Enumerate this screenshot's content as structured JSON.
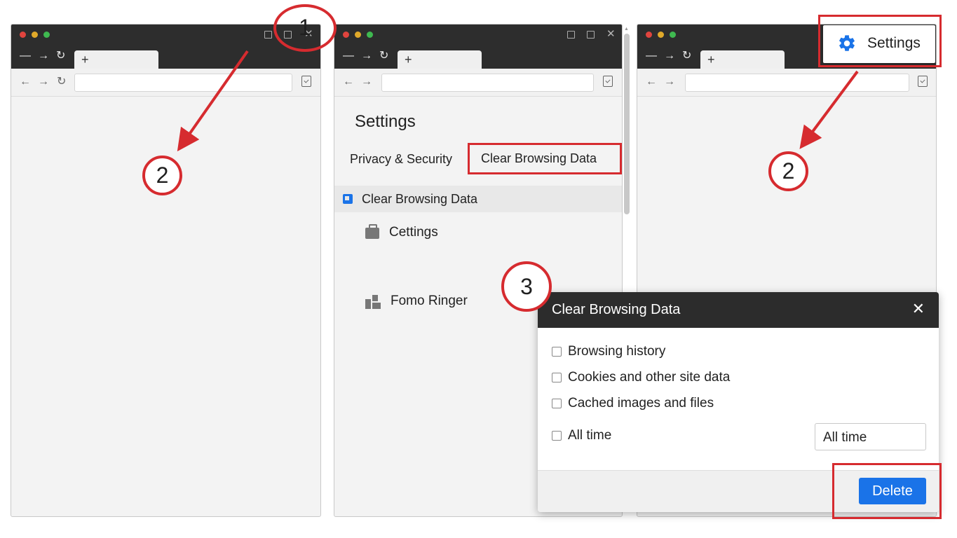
{
  "windows": [
    {
      "new_tab_label": "+"
    },
    {
      "new_tab_label": "+"
    },
    {
      "new_tab_label": "+"
    }
  ],
  "settings_page": {
    "title": "Settings",
    "tabs": [
      "Privacy & Security",
      "Clear Browsing Data"
    ],
    "items": [
      {
        "label": "Clear Browsing Data",
        "icon": "clear-data-icon"
      },
      {
        "label": "Cettings",
        "icon": "briefcase-icon"
      },
      {
        "label": "Fomo Ringer",
        "icon": "puzzle-icon"
      }
    ]
  },
  "settings_popup": {
    "label": "Settings",
    "icon": "gear-icon",
    "icon_color": "#1a73e8"
  },
  "dialog": {
    "title": "Clear Browsing Data",
    "close_glyph": "✕",
    "options": [
      "Browsing history",
      "Cookies and other site data",
      "Cached images and files",
      "All time"
    ],
    "time_range_value": "All time",
    "delete_label": "Delete"
  },
  "annotations": {
    "steps": [
      "1",
      "2",
      "2",
      "3"
    ],
    "color": "#d62b2f"
  },
  "colors": {
    "titlebar": "#2d2d2d",
    "accent": "#1a73e8",
    "annotation_red": "#d62b2f"
  }
}
